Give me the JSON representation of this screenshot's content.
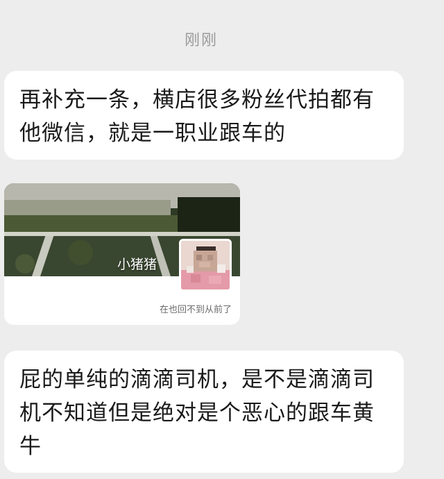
{
  "chat": {
    "timestamp": "刚刚",
    "messages": [
      {
        "type": "text",
        "text": "再补充一条，横店很多粉丝代拍都有他微信，就是一职业跟车的"
      },
      {
        "type": "profile_card",
        "name": "小猪猪",
        "caption": "在也回不到从前了",
        "avatar_icon": "blurred-avatar-icon"
      },
      {
        "type": "text",
        "text": "屁的单纯的滴滴司机，是不是滴滴司机不知道但是绝对是个恶心的跟车黄牛"
      }
    ]
  },
  "colors": {
    "background": "#ededed",
    "bubble": "#ffffff",
    "timestamp": "#9b9b9b"
  }
}
